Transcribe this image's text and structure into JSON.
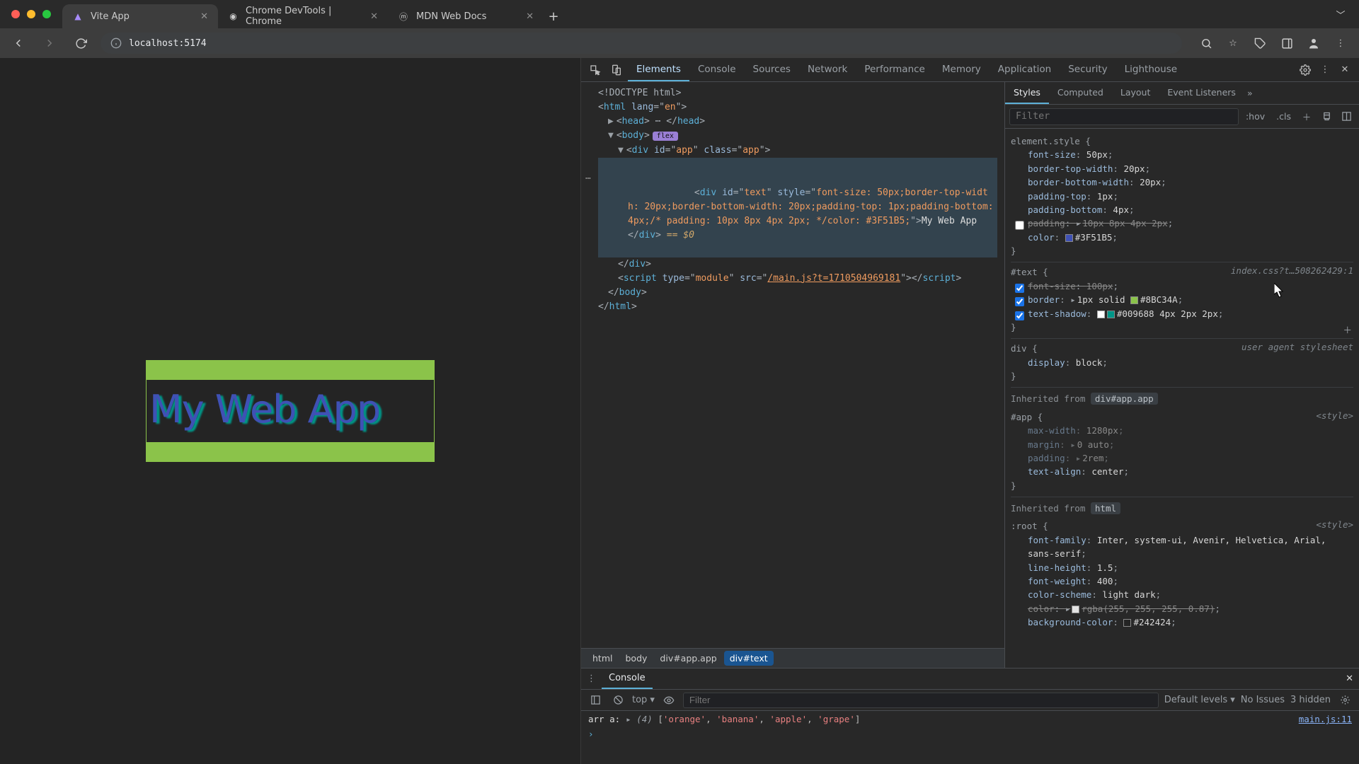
{
  "browser": {
    "tabs": [
      {
        "title": "Vite App",
        "favicon": "⚡"
      },
      {
        "title": "Chrome DevTools | Chrome",
        "favicon": "◎"
      },
      {
        "title": "MDN Web Docs",
        "favicon": "ⓜ"
      }
    ],
    "new_tab": "+",
    "address": "localhost:5174"
  },
  "page": {
    "app_text": "My Web App",
    "text_color": "#3F51B5",
    "border_color": "#8BC34A",
    "shadow_color": "#009688"
  },
  "devtools": {
    "tabs": [
      "Elements",
      "Console",
      "Sources",
      "Network",
      "Performance",
      "Memory",
      "Application",
      "Security",
      "Lighthouse"
    ],
    "active_tab": "Elements",
    "dom": {
      "doctype": "<!DOCTYPE html>",
      "html_open": "<html lang=\"en\">",
      "head": "<head> … </head>",
      "body_open": "<body>",
      "body_pill": "flex",
      "app_open": "<div id=\"app\" class=\"app\">",
      "text_div_part1": "<div id=\"text\" style=\"",
      "text_div_style": "font-size: 50px;border-top-width: 20px;border-bottom-width: 20px;padding-top: 1px;padding-bottom: 4px;/* padding: 10px 8px 4px 2px; */color: #3F51B5;",
      "text_div_part2": "\">",
      "text_div_content": "My Web App",
      "text_div_close": "</div>",
      "eq0": " == $0",
      "app_close": "</div>",
      "script_line": "<script type=\"module\" src=\"/main.js?t=1710504969181\"></scr",
      "script_line_end": "ipt>",
      "body_close": "</body>",
      "html_close": "</html>"
    },
    "crumbs": [
      "html",
      "body",
      "div#app.app",
      "div#text"
    ]
  },
  "styles": {
    "tabs": [
      "Styles",
      "Computed",
      "Layout",
      "Event Listeners"
    ],
    "filter_placeholder": "Filter",
    "toolbar": {
      "hov": ":hov",
      "cls": ".cls"
    },
    "rules": {
      "element_style": {
        "selector": "element.style",
        "decls": [
          {
            "prop": "font-size",
            "val": "50px",
            "checked": true
          },
          {
            "prop": "border-top-width",
            "val": "20px",
            "checked": true
          },
          {
            "prop": "border-bottom-width",
            "val": "20px",
            "checked": true
          },
          {
            "prop": "padding-top",
            "val": "1px",
            "checked": true
          },
          {
            "prop": "padding-bottom",
            "val": "4px",
            "checked": true
          },
          {
            "prop": "padding",
            "val": "10px 8px 4px 2px",
            "checked": false,
            "strike": true,
            "expand": true
          },
          {
            "prop": "color",
            "val": "#3F51B5",
            "checked": true,
            "swatch": "#3F51B5"
          }
        ]
      },
      "text": {
        "selector": "#text",
        "origin": "index.css?t…508262429:1",
        "decls": [
          {
            "prop": "font-size",
            "val": "100px",
            "checked": true,
            "strike": true
          },
          {
            "prop": "border",
            "val": "1px solid #8BC34A",
            "checked": true,
            "expand": true,
            "swatch": "#8BC34A"
          },
          {
            "prop": "text-shadow",
            "val": "#009688 4px 2px 2px",
            "checked": true,
            "swatch": "#009688",
            "shadow": true
          }
        ]
      },
      "uadiv": {
        "selector": "div",
        "origin": "user agent stylesheet",
        "decls": [
          {
            "prop": "display",
            "val": "block"
          }
        ]
      },
      "inh_app_label": "Inherited from ",
      "inh_app_sel": "div#app.app",
      "app": {
        "selector": "#app",
        "origin": "<style>",
        "decls": [
          {
            "prop": "max-width",
            "val": "1280px",
            "dim": true
          },
          {
            "prop": "margin",
            "val": "0 auto",
            "expand": true,
            "dim": true
          },
          {
            "prop": "padding",
            "val": "2rem",
            "expand": true,
            "dim": true
          },
          {
            "prop": "text-align",
            "val": "center"
          }
        ]
      },
      "inh_html_label": "Inherited from ",
      "inh_html_sel": "html",
      "root": {
        "selector": ":root",
        "origin": "<style>",
        "decls": [
          {
            "prop": "font-family",
            "val": "Inter, system-ui, Avenir, Helvetica, Arial, sans-serif"
          },
          {
            "prop": "line-height",
            "val": "1.5"
          },
          {
            "prop": "font-weight",
            "val": "400"
          },
          {
            "prop": "color-scheme",
            "val": "light dark"
          },
          {
            "prop": "color",
            "val": "rgba(255, 255, 255, 0.87)",
            "strike": true,
            "expand": true,
            "swatch": "rgba(255,255,255,0.87)"
          },
          {
            "prop": "background-color",
            "val": "#242424",
            "swatch": "#242424"
          }
        ]
      }
    }
  },
  "console": {
    "title": "Console",
    "context": "top",
    "filter_placeholder": "Filter",
    "levels": "Default levels",
    "issues": "No Issues",
    "hidden": "3 hidden",
    "log": {
      "label": "arr a:",
      "count": "(4)",
      "items": [
        "'orange'",
        "'banana'",
        "'apple'",
        "'grape'"
      ],
      "source": "main.js:11"
    }
  }
}
